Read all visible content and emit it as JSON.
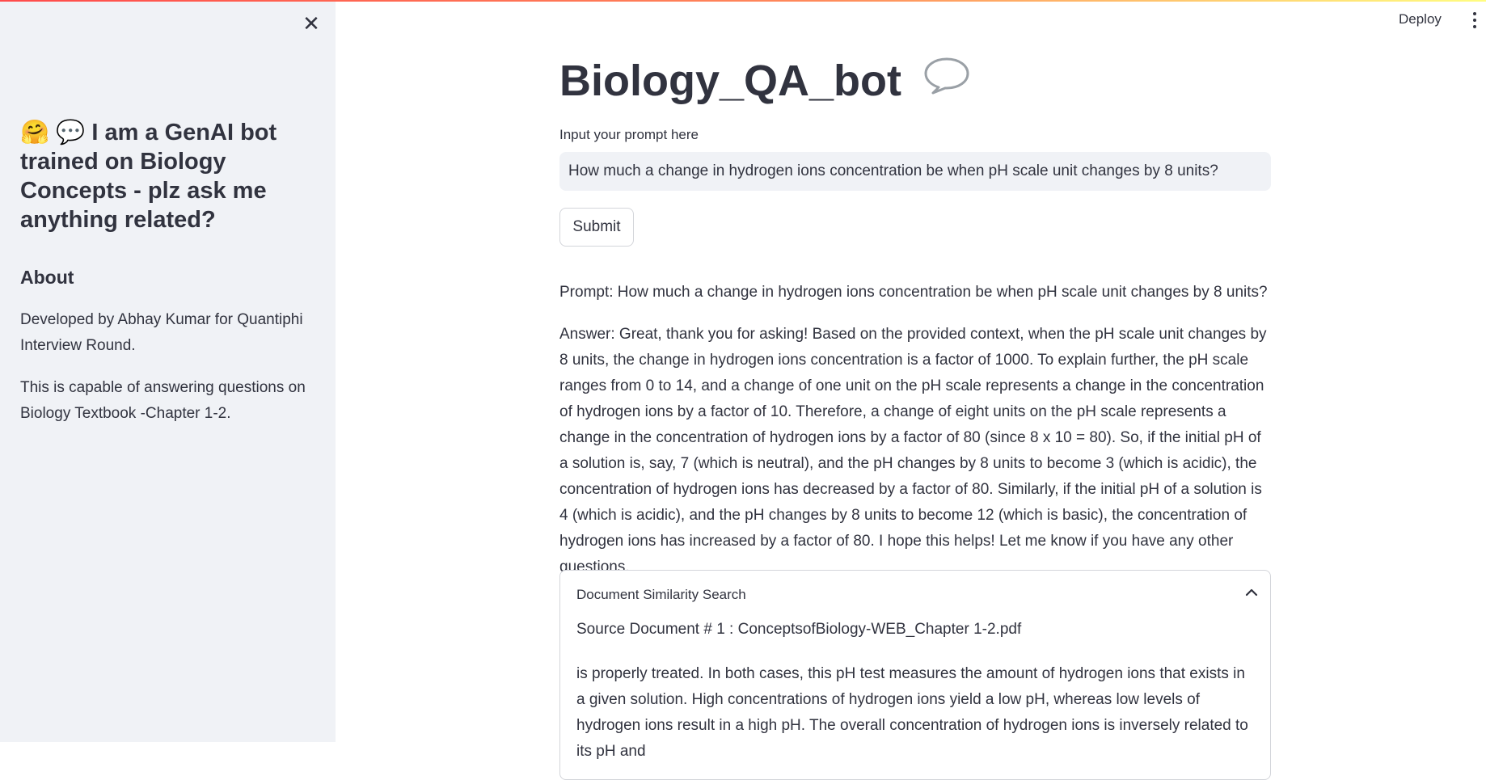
{
  "sidebar": {
    "close_icon": "close-icon",
    "title_emoji_1": "🤗",
    "title_emoji_2": "💬",
    "title": "I am a GenAI bot trained on Biology Concepts - plz ask me anything related?",
    "about_heading": "About",
    "about_paragraph_1": "Developed by Abhay Kumar for Quantiphi Interview Round.",
    "about_paragraph_2": "This is capable of answering questions on Biology Textbook -Chapter 1-2."
  },
  "header": {
    "deploy_label": "Deploy",
    "menu_icon": "kebab-menu-icon"
  },
  "main": {
    "title": "Biology_QA_bot",
    "title_icon": "speech-bubble-icon",
    "input_label": "Input your prompt here",
    "input_value": "How much a change in hydrogen ions concentration be when pH scale unit changes by 8 units?",
    "submit_label": "Submit",
    "prompt_echo": "Prompt: How much a change in hydrogen ions concentration be when pH scale unit changes by 8 units?",
    "answer": "Answer: Great, thank you for asking! Based on the provided context, when the pH scale unit changes by 8 units, the change in hydrogen ions concentration is a factor of 1000. To explain further, the pH scale ranges from 0 to 14, and a change of one unit on the pH scale represents a change in the concentration of hydrogen ions by a factor of 10. Therefore, a change of eight units on the pH scale represents a change in the concentration of hydrogen ions by a factor of 80 (since 8 x 10 = 80). So, if the initial pH of a solution is, say, 7 (which is neutral), and the pH changes by 8 units to become 3 (which is acidic), the concentration of hydrogen ions has decreased by a factor of 80. Similarly, if the initial pH of a solution is 4 (which is acidic), and the pH changes by 8 units to become 12 (which is basic), the concentration of hydrogen ions has increased by a factor of 80. I hope this helps! Let me know if you have any other questions.",
    "expander": {
      "header": "Document Similarity Search",
      "chevron_icon": "chevron-up-icon",
      "source_doc": "Source Document # 1 : ConceptsofBiology-WEB_Chapter 1-2.pdf",
      "source_text": "is properly treated. In both cases, this pH test measures the amount of hydrogen ions that exists in a given solution. High concentrations of hydrogen ions yield a low pH, whereas low levels of hydrogen ions result in a high pH. The overall concentration of hydrogen ions is inversely related to its pH and"
    }
  }
}
